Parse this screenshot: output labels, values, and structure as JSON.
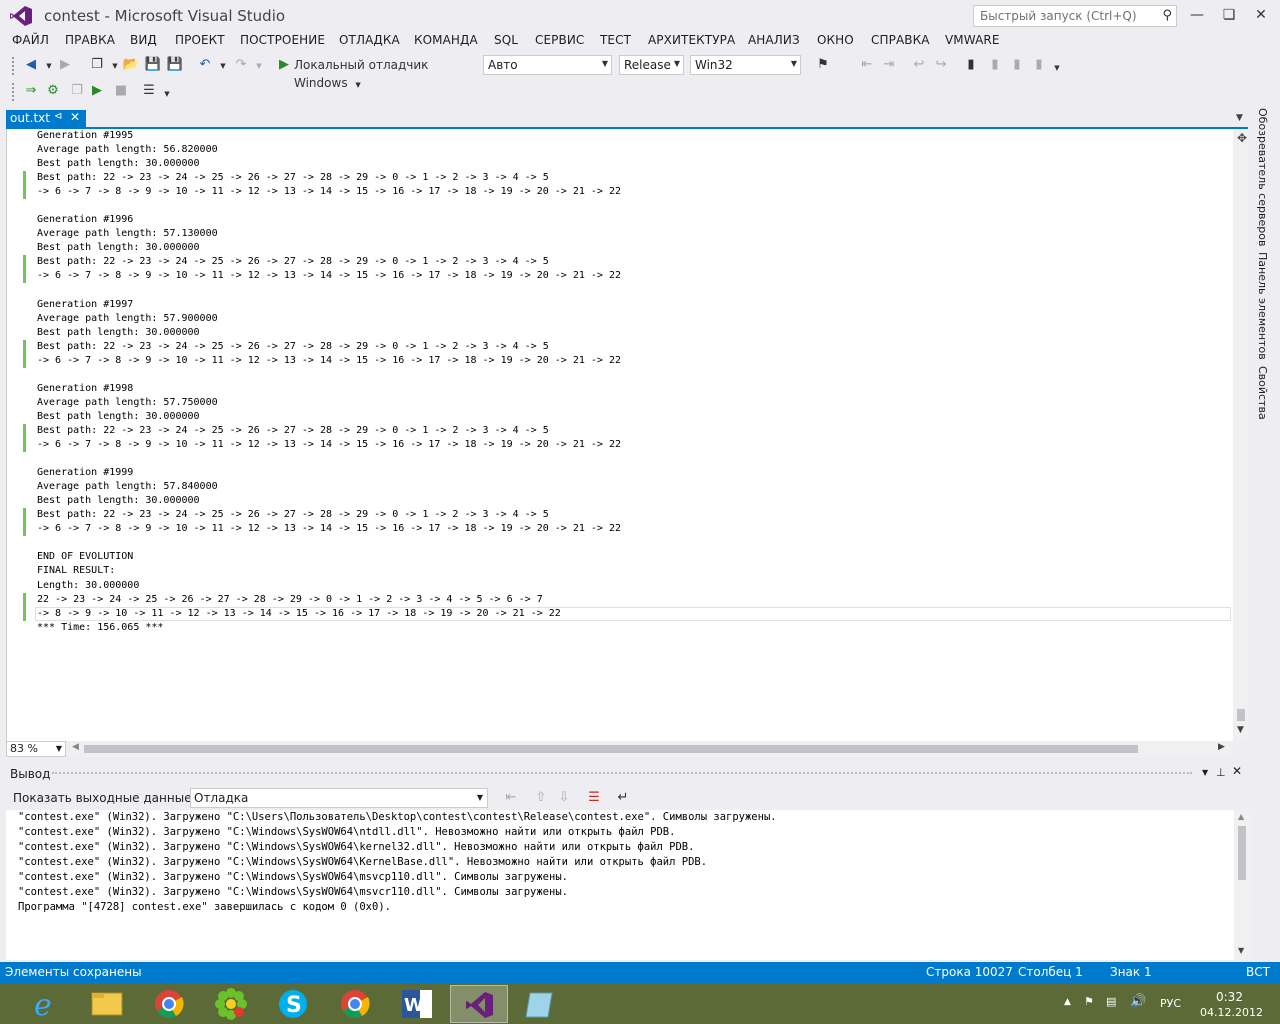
{
  "window": {
    "title": "contest - Microsoft Visual Studio",
    "quick_launch_placeholder": "Быстрый запуск (Ctrl+Q)"
  },
  "menu": [
    "ФАЙЛ",
    "ПРАВКА",
    "ВИД",
    "ПРОЕКТ",
    "ПОСТРОЕНИЕ",
    "ОТЛАДКА",
    "КОМАНДА",
    "SQL",
    "СЕРВИС",
    "ТЕСТ",
    "АРХИТЕКТУРА",
    "АНАЛИЗ",
    "ОКНО",
    "СПРАВКА",
    "VMWARE"
  ],
  "toolbar": {
    "debugger_label": "Локальный отладчик Windows",
    "solution_config_auto": "Авто",
    "build_config": "Release",
    "platform": "Win32"
  },
  "document_tab": {
    "name": "out.txt"
  },
  "editor": {
    "lines": [
      "Generation #1995",
      "Average path length: 56.820000",
      "Best path length: 30.000000",
      "Best path: 22 -> 23 -> 24 -> 25 -> 26 -> 27 -> 28 -> 29 -> 0 -> 1 -> 2 -> 3 -> 4 -> 5",
      "-> 6 -> 7 -> 8 -> 9 -> 10 -> 11 -> 12 -> 13 -> 14 -> 15 -> 16 -> 17 -> 18 -> 19 -> 20 -> 21 -> 22",
      "",
      "Generation #1996",
      "Average path length: 57.130000",
      "Best path length: 30.000000",
      "Best path: 22 -> 23 -> 24 -> 25 -> 26 -> 27 -> 28 -> 29 -> 0 -> 1 -> 2 -> 3 -> 4 -> 5",
      "-> 6 -> 7 -> 8 -> 9 -> 10 -> 11 -> 12 -> 13 -> 14 -> 15 -> 16 -> 17 -> 18 -> 19 -> 20 -> 21 -> 22",
      "",
      "Generation #1997",
      "Average path length: 57.900000",
      "Best path length: 30.000000",
      "Best path: 22 -> 23 -> 24 -> 25 -> 26 -> 27 -> 28 -> 29 -> 0 -> 1 -> 2 -> 3 -> 4 -> 5",
      "-> 6 -> 7 -> 8 -> 9 -> 10 -> 11 -> 12 -> 13 -> 14 -> 15 -> 16 -> 17 -> 18 -> 19 -> 20 -> 21 -> 22",
      "",
      "Generation #1998",
      "Average path length: 57.750000",
      "Best path length: 30.000000",
      "Best path: 22 -> 23 -> 24 -> 25 -> 26 -> 27 -> 28 -> 29 -> 0 -> 1 -> 2 -> 3 -> 4 -> 5",
      "-> 6 -> 7 -> 8 -> 9 -> 10 -> 11 -> 12 -> 13 -> 14 -> 15 -> 16 -> 17 -> 18 -> 19 -> 20 -> 21 -> 22",
      "",
      "Generation #1999",
      "Average path length: 57.840000",
      "Best path length: 30.000000",
      "Best path: 22 -> 23 -> 24 -> 25 -> 26 -> 27 -> 28 -> 29 -> 0 -> 1 -> 2 -> 3 -> 4 -> 5",
      "-> 6 -> 7 -> 8 -> 9 -> 10 -> 11 -> 12 -> 13 -> 14 -> 15 -> 16 -> 17 -> 18 -> 19 -> 20 -> 21 -> 22",
      "",
      "END OF EVOLUTION",
      "FINAL RESULT:",
      "Length: 30.000000",
      "22 -> 23 -> 24 -> 25 -> 26 -> 27 -> 28 -> 29 -> 0 -> 1 -> 2 -> 3 -> 4 -> 5 -> 6 -> 7",
      "-> 8 -> 9 -> 10 -> 11 -> 12 -> 13 -> 14 -> 15 -> 16 -> 17 -> 18 -> 19 -> 20 -> 21 -> 22",
      "*** Time: 156.065 ***"
    ],
    "changed_lines": [
      3,
      4,
      9,
      10,
      15,
      16,
      21,
      22,
      27,
      28,
      33,
      34
    ],
    "current_line": 34,
    "zoom": "83 %"
  },
  "side_tabs": [
    "Обозреватель серверов",
    "Панель элементов",
    "Свойства"
  ],
  "output": {
    "title": "Вывод",
    "show_label": "Показать выходные данные от:",
    "source": "Отладка",
    "lines": [
      "\"contest.exe\" (Win32). Загружено \"C:\\Users\\Пользователь\\Desktop\\contest\\contest\\Release\\contest.exe\". Символы загружены.",
      "\"contest.exe\" (Win32). Загружено \"C:\\Windows\\SysWOW64\\ntdll.dll\". Невозможно найти или открыть файл PDB.",
      "\"contest.exe\" (Win32). Загружено \"C:\\Windows\\SysWOW64\\kernel32.dll\". Невозможно найти или открыть файл PDB.",
      "\"contest.exe\" (Win32). Загружено \"C:\\Windows\\SysWOW64\\KernelBase.dll\". Невозможно найти или открыть файл PDB.",
      "\"contest.exe\" (Win32). Загружено \"C:\\Windows\\SysWOW64\\msvcp110.dll\". Символы загружены.",
      "\"contest.exe\" (Win32). Загружено \"C:\\Windows\\SysWOW64\\msvcr110.dll\". Символы загружены.",
      "Программа \"[4728] contest.exe\" завершилась с кодом 0 (0x0)."
    ]
  },
  "status": {
    "message": "Элементы сохранены",
    "line": "Строка 10027",
    "column": "Столбец 1",
    "char": "Знак 1",
    "mode": "ВСТ"
  },
  "taskbar": {
    "apps": [
      "internet-explorer",
      "file-explorer",
      "chrome",
      "icq",
      "skype",
      "chrome",
      "word",
      "visual-studio",
      "notepad"
    ],
    "active_app": "visual-studio",
    "language": "РУС",
    "time": "0:32",
    "date": "04.12.2012"
  },
  "colors": {
    "accent": "#007acc",
    "change_marker": "#6fc75b",
    "chrome_bg": "#eeeef2"
  }
}
